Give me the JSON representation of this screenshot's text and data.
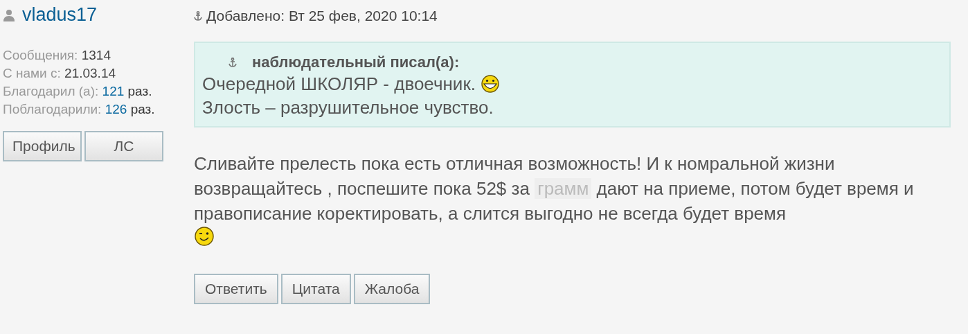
{
  "author": {
    "name": "vladus17"
  },
  "stats": [
    {
      "label": "Сообщения:",
      "value": "1314",
      "linked": false
    },
    {
      "label": "С нами с:",
      "value": "21.03.14",
      "linked": false
    },
    {
      "label": "Благодарил (а):",
      "value": "121",
      "unit": "раз.",
      "linked": true
    },
    {
      "label": "Поблагодарили:",
      "value": "126",
      "unit": "раз.",
      "linked": true
    }
  ],
  "profile_buttons": [
    "Профиль",
    "ЛС"
  ],
  "post": {
    "date": "Добавлено: Вт 25 фев, 2020 10:14",
    "quote": {
      "author": "наблюдательный писал(а):",
      "lines": [
        {
          "text": "Очередной ШКОЛЯР - двоечник.",
          "emoji": {
            "kind": "grin"
          }
        },
        {
          "text": "Злость – разрушительное чувство."
        }
      ]
    },
    "body": {
      "before": "Сливайте прелесть пока есть отличная возможность! И к номральной жизни возвращайтесь , поспешите пока 52$ за",
      "link": "грамм",
      "after": "дают на приеме, потом будет время и правописание коректировать, а слится выгодно не всегда будет время",
      "emoji": {
        "kind": "wink"
      }
    }
  },
  "actions": [
    "Ответить",
    "Цитата",
    "Жалоба"
  ]
}
